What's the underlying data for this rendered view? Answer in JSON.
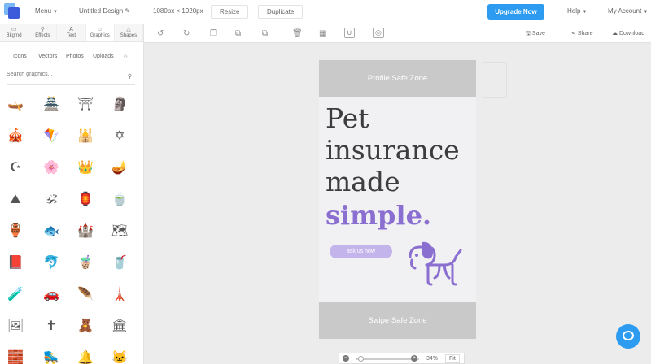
{
  "topbar": {
    "menu": "Menu",
    "title": "Untitled Design",
    "dimensions": "1080px × 1920px",
    "resize": "Resize",
    "duplicate": "Duplicate",
    "upgrade": "Upgrade Now",
    "help": "Help",
    "account": "My Account"
  },
  "panel": {
    "tabs": [
      {
        "label": "Bkgrnd",
        "icon": "image-icon"
      },
      {
        "label": "Effects",
        "icon": "wand-icon"
      },
      {
        "label": "Text",
        "icon": "text-icon"
      },
      {
        "label": "Graphics",
        "icon": "graphics-icon"
      },
      {
        "label": "Shapes",
        "icon": "shapes-icon"
      }
    ],
    "subtabs": [
      "Icons",
      "Vectors",
      "Photos",
      "Uploads",
      "☆"
    ],
    "search_placeholder": "Search graphics...",
    "icons": [
      "🛶",
      "🏯",
      "⛩",
      "🗿",
      "🎪",
      "🪁",
      "🕌",
      "✡",
      "☪",
      "🌸",
      "👑",
      "🪔",
      "⛰",
      "🕉",
      "🏮",
      "🍵",
      "🏺",
      "🐟",
      "🏰",
      "🗺",
      "📕",
      "🐬",
      "🧋",
      "🥤",
      "🧪",
      "🚗",
      "🪶",
      "🗼",
      "🖼",
      "✝",
      "🧸",
      "🏛",
      "🧱",
      "🛼",
      "🔔",
      "🐱"
    ]
  },
  "toolbar": {
    "save": "Save",
    "share": "Share",
    "download": "Download"
  },
  "canvas": {
    "top_zone": "Profile Safe Zone",
    "bottom_zone": "Swipe Safe Zone",
    "headline_line1": "Pet",
    "headline_line2": "insurance",
    "headline_line3": "made",
    "headline_emphasis": "simple.",
    "cta": "ask us how",
    "accent_color": "#8a6fd0"
  },
  "zoom": {
    "value": "34%",
    "fit": "Fit"
  }
}
